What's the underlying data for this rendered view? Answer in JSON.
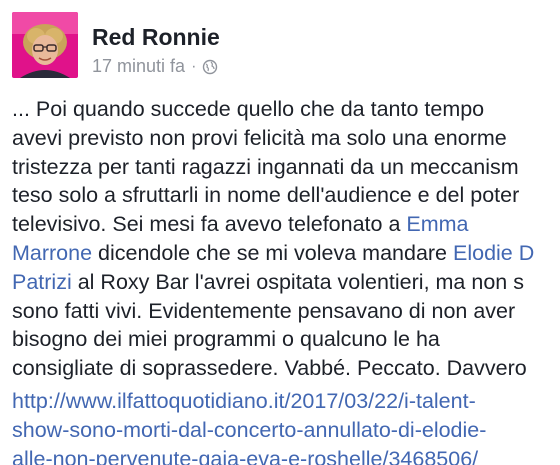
{
  "post": {
    "author": "Red Ronnie",
    "time": "17 minuti fa",
    "separator": "·",
    "privacy_icon": "globe-icon",
    "body": {
      "l1": "... Poi quando succede quello che da tanto tempo",
      "l2": "avevi previsto non provi felicità ma solo una enorme",
      "l3": "tristezza per tanti ragazzi ingannati da un meccanism",
      "l4": "teso solo a sfruttarli in nome dell'audience e del poter",
      "l5": "televisivo. Sei mesi fa avevo telefonato a ",
      "l5_mention": "Emma",
      "l6_mention": "Marrone",
      "l6": " dicendole che se mi voleva mandare ",
      "l6_mention2": "Elodie D",
      "l7_mention": "Patrizi",
      "l7": " al Roxy Bar l'avrei ospitata volentieri, ma non s",
      "l8": "sono fatti vivi. Evidentemente pensavano di non aver",
      "l9": "bisogno dei miei programmi o qualcuno le ha",
      "l10": "consigliate di soprassedere. Vabbé. Peccato. Davvero"
    },
    "link": {
      "l1": "http://www.ilfattoquotidiano.it/2017/03/22/i-talent-",
      "l2": "show-sono-morti-dal-concerto-annullato-di-elodie-",
      "l3": "alle-non-pervenute-gaia-eva-e-roshelle/3468506/"
    },
    "colors": {
      "link": "#4267b2",
      "text": "#1d2129",
      "meta": "#90949c",
      "avatar_bg": "#e0128a"
    }
  }
}
